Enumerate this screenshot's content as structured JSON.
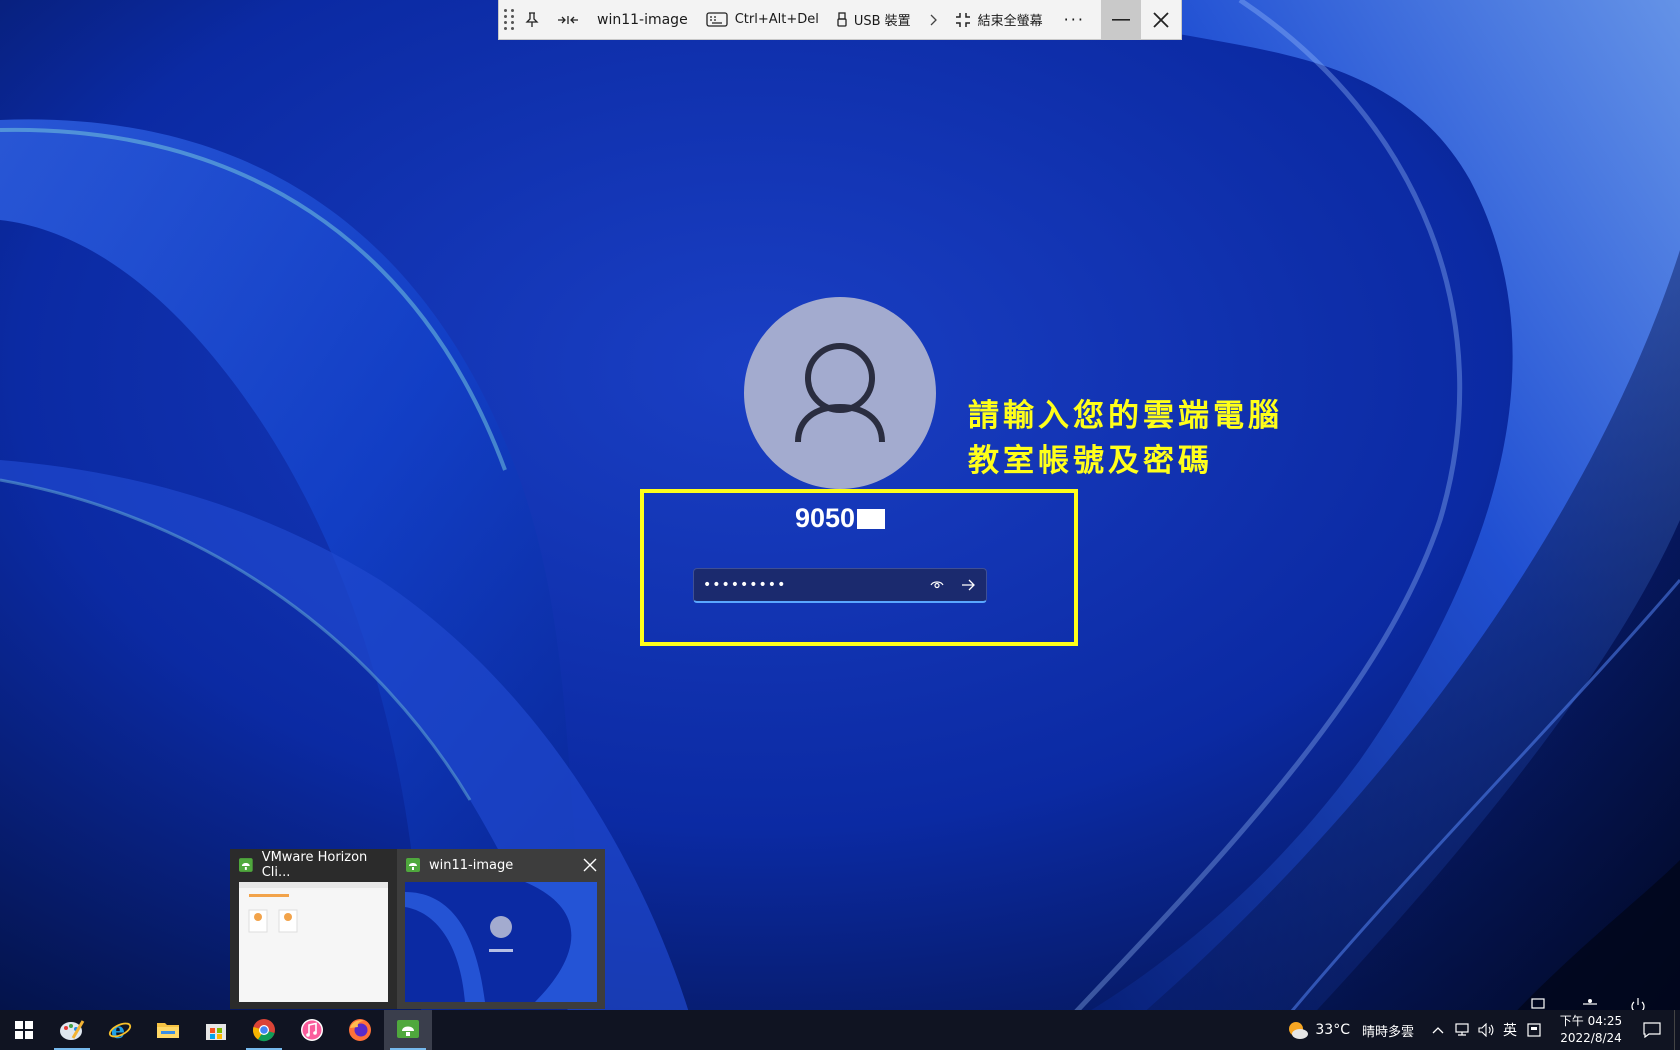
{
  "toolbar": {
    "pin_icon": "pin-icon",
    "fit_icon": "fit-window-icon",
    "title": "win11-image",
    "cad_label": "Ctrl+Alt+Del",
    "usb_label": "USB 裝置",
    "exit_fullscreen_label": "結束全螢幕",
    "more_label": "···"
  },
  "login": {
    "username": "9050",
    "password_placeholder": "",
    "password_value": "●●●●●●●●●",
    "annotation_line1": "請輸入您的雲端電腦",
    "annotation_line2": "教室帳號及密碼",
    "highlight_color": "#ffff1a"
  },
  "preview": {
    "card1_title": "VMware Horizon Cli...",
    "card2_title": "win11-image"
  },
  "taskbar": {
    "apps": [
      "start",
      "paint",
      "internet-explorer",
      "file-explorer",
      "store",
      "chrome",
      "itunes",
      "firefox",
      "horizon-client"
    ],
    "weather_temp": "33°C",
    "weather_cond": "晴時多雲",
    "ime_label": "英",
    "clock_time": "下午 04:25",
    "clock_date": "2022/8/24"
  },
  "colors": {
    "accent_blue": "#0a2a9e",
    "annotation_yellow": "#ffff1a",
    "taskbar_bg": "#101422"
  }
}
